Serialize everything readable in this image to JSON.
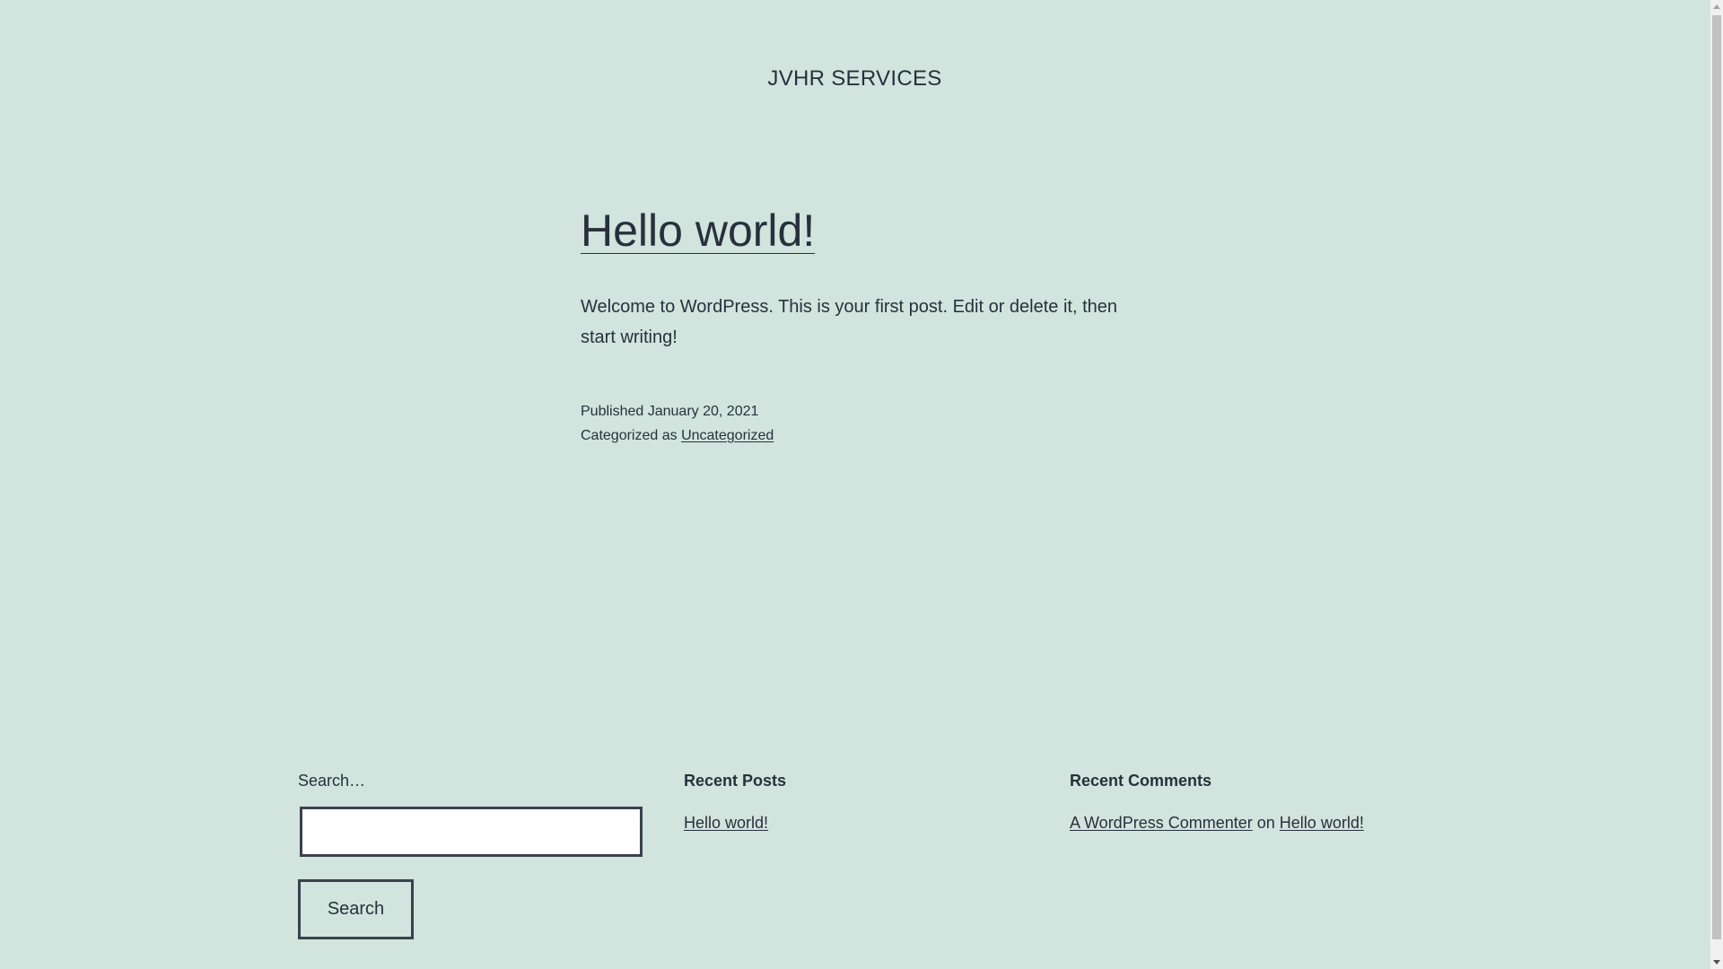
{
  "header": {
    "site_title": "JVHR SERVICES"
  },
  "post": {
    "title": "Hello world!",
    "content": "Welcome to WordPress. This is your first post. Edit or delete it, then start writing!",
    "published_label": "Published",
    "published_date": "January 20, 2021",
    "categorized_label": "Categorized as",
    "category": "Uncategorized"
  },
  "search_widget": {
    "label": "Search…",
    "input_value": "",
    "button_label": "Search"
  },
  "recent_posts": {
    "heading": "Recent Posts",
    "items": [
      "Hello world!"
    ]
  },
  "recent_comments": {
    "heading": "Recent Comments",
    "author": "A WordPress Commenter",
    "connector": "on",
    "post": "Hello world!"
  },
  "colors": {
    "background": "#d1e4dd",
    "text": "#28303d"
  }
}
